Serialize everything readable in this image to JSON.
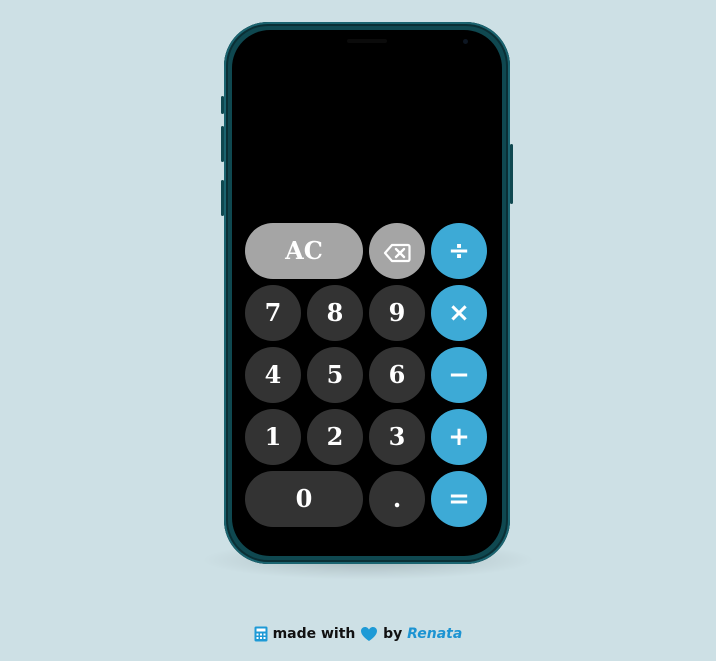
{
  "display": {
    "value": ""
  },
  "keypad": {
    "clear": "AC",
    "backspace_icon": "backspace-icon",
    "divide": "÷",
    "multiply": "×",
    "subtract": "−",
    "add": "+",
    "equals": "=",
    "decimal": ".",
    "digits": {
      "d0": "0",
      "d1": "1",
      "d2": "2",
      "d3": "3",
      "d4": "4",
      "d5": "5",
      "d6": "6",
      "d7": "7",
      "d8": "8",
      "d9": "9"
    }
  },
  "footer": {
    "icon": "calculator-icon",
    "made_with": "made with",
    "heart_icon": "heart-icon",
    "by": "by",
    "author": "Renata"
  },
  "colors": {
    "background": "#cde0e5",
    "phone_frame": "#0f4850",
    "number_key": "#333333",
    "function_key": "#a5a5a5",
    "operator_key": "#3daad6",
    "heart": "#1d9ad6",
    "author_link": "#1d94d2"
  }
}
